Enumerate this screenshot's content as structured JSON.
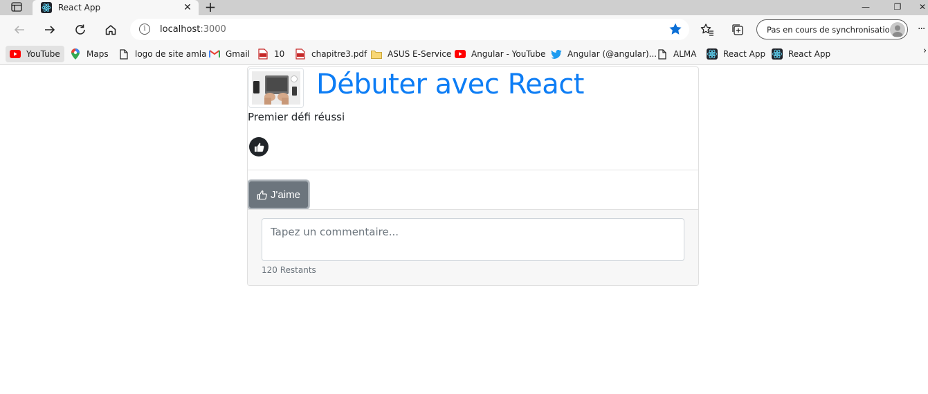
{
  "browser": {
    "tab": {
      "title": "React App",
      "close_glyph": "✕"
    },
    "newtab_glyph": "+",
    "window_controls": {
      "minimize": "—",
      "restore": "❐",
      "close": "✕"
    },
    "address": {
      "host": "localhost",
      "port": ":3000"
    },
    "sync_label": "Pas en cours de synchronisation",
    "more_glyph": "···",
    "bookmarks": [
      {
        "label": "YouTube",
        "icon": "youtube-icon"
      },
      {
        "label": "Maps",
        "icon": "maps-pin-icon"
      },
      {
        "label": "logo de site amla",
        "icon": "page-icon"
      },
      {
        "label": "Gmail",
        "icon": "gmail-icon"
      },
      {
        "label": "10",
        "icon": "pdf-icon"
      },
      {
        "label": "chapitre3.pdf",
        "icon": "pdf-icon"
      },
      {
        "label": "ASUS E-Service",
        "icon": "folder-icon"
      },
      {
        "label": "Angular - YouTube",
        "icon": "youtube-icon"
      },
      {
        "label": "Angular (@angular)...",
        "icon": "twitter-icon"
      },
      {
        "label": "ALMA",
        "icon": "page-icon"
      },
      {
        "label": "React App",
        "icon": "react-icon"
      },
      {
        "label": "React App",
        "icon": "react-icon"
      }
    ],
    "bookmarks_overflow": "›",
    "accent": "#0b6fd6"
  },
  "page": {
    "title": "Débuter avec React",
    "subtitle": "Premier défi réussi",
    "like_button_label": "J'aime",
    "comment_placeholder": "Tapez un commentaire...",
    "remaining_text": "120 Restants",
    "title_color": "#0d7df5",
    "button_color": "#6c757d"
  }
}
